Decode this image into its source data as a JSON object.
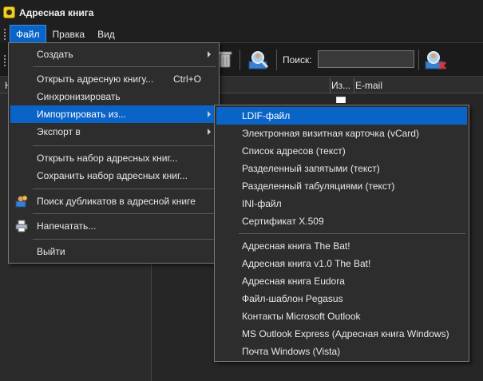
{
  "window": {
    "title": "Адресная книга"
  },
  "menubar": {
    "items": [
      "Файл",
      "Правка",
      "Вид"
    ]
  },
  "toolbar": {
    "search_label": "Поиск:",
    "search_value": ""
  },
  "table": {
    "columns": [
      "Н",
      "Из...",
      "E-mail"
    ]
  },
  "file_menu": {
    "items": [
      {
        "label": "Создать",
        "shortcut": "",
        "has_submenu": true
      },
      {
        "label": "Открыть адресную книгу...",
        "shortcut": "Ctrl+O",
        "has_submenu": false
      },
      {
        "label": "Синхронизировать",
        "shortcut": "",
        "has_submenu": false
      },
      {
        "label": "Импортировать из...",
        "shortcut": "",
        "has_submenu": true,
        "highlighted": true
      },
      {
        "label": "Экспорт в",
        "shortcut": "",
        "has_submenu": true
      },
      {
        "label": "Открыть набор адресных книг...",
        "shortcut": "",
        "has_submenu": false
      },
      {
        "label": "Сохранить набор адресных книг...",
        "shortcut": "",
        "has_submenu": false
      },
      {
        "label": "Поиск дубликатов в адресной книге",
        "shortcut": "",
        "has_submenu": false,
        "icon": "duplicates-icon"
      },
      {
        "label": "Напечатать...",
        "shortcut": "",
        "has_submenu": false,
        "icon": "printer-icon"
      },
      {
        "label": "Выйти",
        "shortcut": "",
        "has_submenu": false
      }
    ]
  },
  "import_submenu": {
    "items": [
      {
        "label": "LDIF-файл",
        "highlighted": true
      },
      {
        "label": "Электронная визитная карточка (vCard)"
      },
      {
        "label": "Список адресов (текст)"
      },
      {
        "label": "Разделенный запятыми (текст)"
      },
      {
        "label": "Разделенный табуляциями (текст)"
      },
      {
        "label": "INI-файл"
      },
      {
        "label": "Сертификат X.509"
      },
      {
        "label": "Адресная книга The Bat!"
      },
      {
        "label": "Адресная книга v1.0 The Bat!"
      },
      {
        "label": "Адресная книга Eudora"
      },
      {
        "label": "Файл-шаблон Pegasus"
      },
      {
        "label": "Контакты Microsoft Outlook"
      },
      {
        "label": "MS Outlook Express (Адресная книга Windows)"
      },
      {
        "label": "Почта Windows (Vista)"
      }
    ]
  },
  "colors": {
    "highlight": "#0a64c8",
    "background": "#2b2b2b",
    "menu_bg": "#2d2d2d"
  }
}
